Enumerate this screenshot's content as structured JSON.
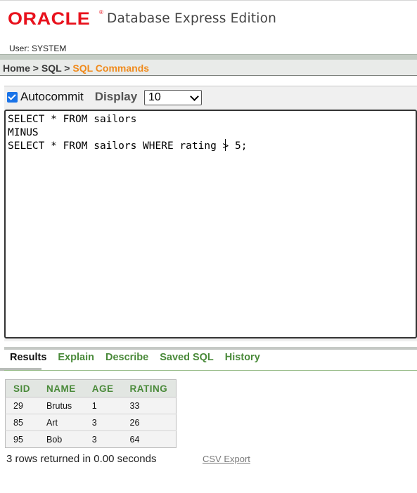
{
  "header": {
    "logo": "ORACLE",
    "logo_mark": "®",
    "product": "Database Express Edition",
    "user": "User: SYSTEM"
  },
  "breadcrumb": {
    "home": "Home",
    "sep": ">",
    "sql": "SQL",
    "current": "SQL Commands"
  },
  "options": {
    "autocommit_label": "Autocommit",
    "autocommit_checked": true,
    "display_label": "Display",
    "display_value": "10"
  },
  "editor": {
    "line1": "SELECT * FROM sailors",
    "line2": "MINUS",
    "line3": "SELECT * FROM sailors WHERE rating > 5;"
  },
  "tabs": [
    {
      "label": "Results",
      "active": true
    },
    {
      "label": "Explain"
    },
    {
      "label": "Describe"
    },
    {
      "label": "Saved SQL"
    },
    {
      "label": "History"
    }
  ],
  "results": {
    "columns": [
      "SID",
      "NAME",
      "AGE",
      "RATING"
    ],
    "rows": [
      [
        "29",
        "Brutus",
        "1",
        "33"
      ],
      [
        "85",
        "Art",
        "3",
        "26"
      ],
      [
        "95",
        "Bob",
        "3",
        "64"
      ]
    ],
    "status": "3 rows returned in 0.00 seconds",
    "csv_export": "CSV Export"
  },
  "colors": {
    "oracle_red": "#e8111c",
    "breadcrumb_current": "#f08a1b",
    "tab_green": "#4a8a3a"
  }
}
